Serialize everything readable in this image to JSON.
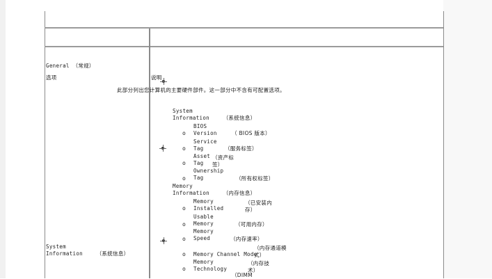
{
  "left_column": {
    "general": "General （常规）",
    "option": "选项",
    "system_information": "System\nInformation　　　（系统信息）"
  },
  "right_column": {
    "description": "说明",
    "intro": "此部分列出您计算机的主要硬件部件。这一部分中不含有可配置选项。",
    "sections": [
      {
        "heading": "System\nInformation　　　（系统信息）"
      },
      {
        "heading": "Memory\nInformation　　　（内存信息）"
      }
    ],
    "items": [
      {
        "bullet": "o",
        "label": "BIOS\nVersion",
        "note": "（ BIOS 版本）"
      },
      {
        "bullet": "o",
        "label": "Service\nTag",
        "note": "（服务标签）"
      },
      {
        "bullet": "o",
        "label": "Asset\nTag",
        "note": "（资产标\n签）"
      },
      {
        "bullet": "o",
        "label": "Ownership\nTag",
        "note": "（所有权标签）"
      },
      {
        "bullet": "o",
        "label": "Memory\nInstalled",
        "note": "（已安装内\n存）"
      },
      {
        "bullet": "o",
        "label": "Usable\nMemory",
        "note": "（可用内存）"
      },
      {
        "bullet": "o",
        "label": "Memory\nSpeed",
        "note": "（内存速率）"
      },
      {
        "bullet": "o",
        "label": "Memory Channel Mode",
        "note": "（内存通道模\n式）"
      },
      {
        "bullet": "o",
        "label": "Memory\nTechnology",
        "note": "（内存技\n术）"
      },
      {
        "bullet": "",
        "label": "",
        "note": "（DIMM"
      }
    ]
  }
}
